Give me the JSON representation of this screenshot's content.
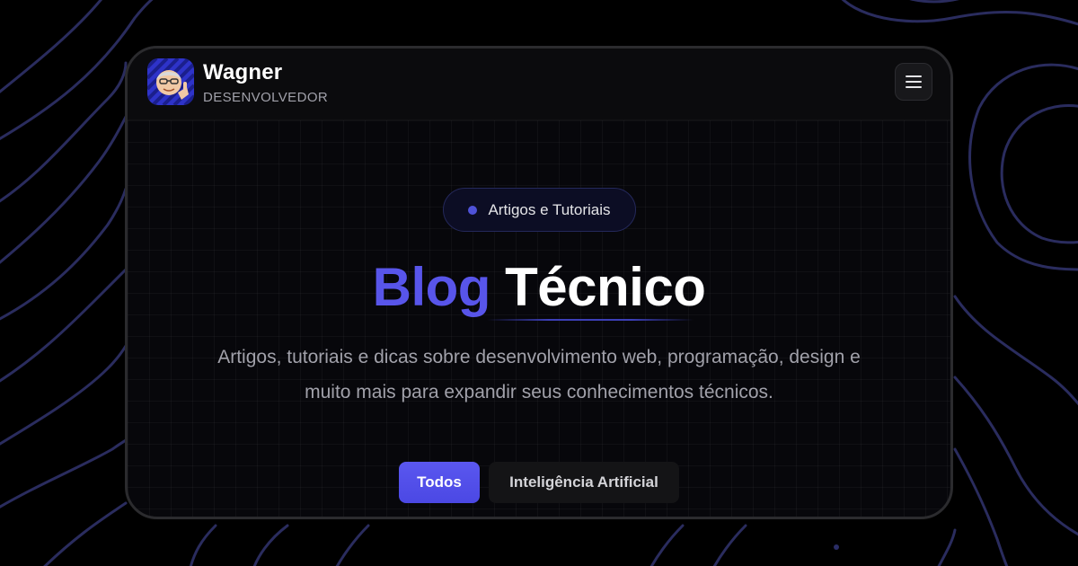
{
  "header": {
    "name": "Wagner",
    "role": "DESENVOLVEDOR",
    "avatar_icon": "memoji-avatar",
    "menu_icon": "hamburger-menu-icon"
  },
  "hero": {
    "badge": "Artigos e Tutoriais",
    "title_accent": "Blog",
    "title_main": "Técnico",
    "description_line1": "Artigos, tutoriais e dicas sobre desenvolvimento web, programação, design e",
    "description_line2": "muito mais para expandir seus conhecimentos técnicos."
  },
  "filters": {
    "active": "Todos",
    "items": [
      "Todos",
      "Inteligência Artificial"
    ]
  },
  "colors": {
    "accent": "#5855ea",
    "background": "#000000",
    "card": "#07070b",
    "muted_text": "#a1a1aa"
  }
}
